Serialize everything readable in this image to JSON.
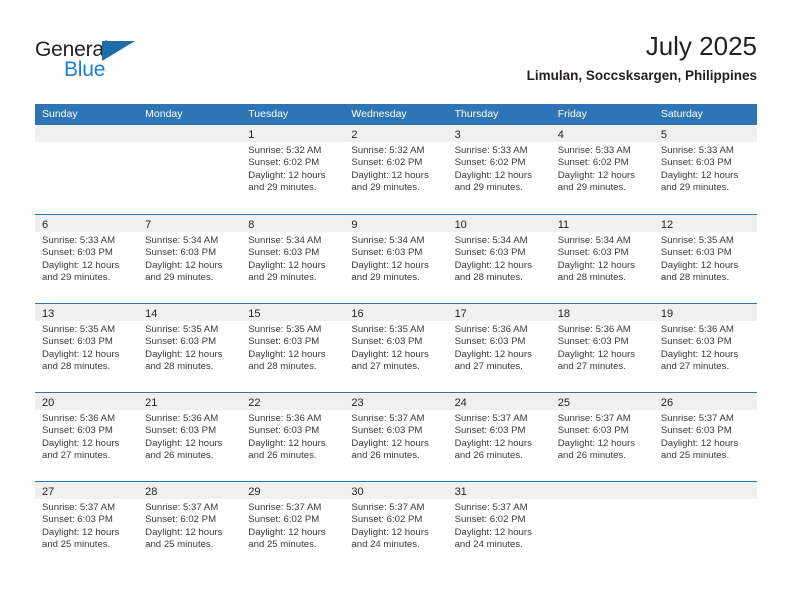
{
  "brand": {
    "name_part1": "General",
    "name_part2": "Blue",
    "triangle_color": "#1b6ca8",
    "blue_color": "#1b7fd4"
  },
  "header": {
    "title": "July 2025",
    "subtitle": "Limulan, Soccsksargen, Philippines"
  },
  "theme": {
    "header_blue": "#2e75b6",
    "daynum_band": "#f0f0f0",
    "text": "#231f20"
  },
  "calendar": {
    "weekday_headers": [
      "Sunday",
      "Monday",
      "Tuesday",
      "Wednesday",
      "Thursday",
      "Friday",
      "Saturday"
    ],
    "weeks": [
      [
        {
          "day": "",
          "sunrise": "",
          "sunset": "",
          "daylight1": "",
          "daylight2": ""
        },
        {
          "day": "",
          "sunrise": "",
          "sunset": "",
          "daylight1": "",
          "daylight2": ""
        },
        {
          "day": "1",
          "sunrise": "Sunrise: 5:32 AM",
          "sunset": "Sunset: 6:02 PM",
          "daylight1": "Daylight: 12 hours",
          "daylight2": "and 29 minutes."
        },
        {
          "day": "2",
          "sunrise": "Sunrise: 5:32 AM",
          "sunset": "Sunset: 6:02 PM",
          "daylight1": "Daylight: 12 hours",
          "daylight2": "and 29 minutes."
        },
        {
          "day": "3",
          "sunrise": "Sunrise: 5:33 AM",
          "sunset": "Sunset: 6:02 PM",
          "daylight1": "Daylight: 12 hours",
          "daylight2": "and 29 minutes."
        },
        {
          "day": "4",
          "sunrise": "Sunrise: 5:33 AM",
          "sunset": "Sunset: 6:02 PM",
          "daylight1": "Daylight: 12 hours",
          "daylight2": "and 29 minutes."
        },
        {
          "day": "5",
          "sunrise": "Sunrise: 5:33 AM",
          "sunset": "Sunset: 6:03 PM",
          "daylight1": "Daylight: 12 hours",
          "daylight2": "and 29 minutes."
        }
      ],
      [
        {
          "day": "6",
          "sunrise": "Sunrise: 5:33 AM",
          "sunset": "Sunset: 6:03 PM",
          "daylight1": "Daylight: 12 hours",
          "daylight2": "and 29 minutes."
        },
        {
          "day": "7",
          "sunrise": "Sunrise: 5:34 AM",
          "sunset": "Sunset: 6:03 PM",
          "daylight1": "Daylight: 12 hours",
          "daylight2": "and 29 minutes."
        },
        {
          "day": "8",
          "sunrise": "Sunrise: 5:34 AM",
          "sunset": "Sunset: 6:03 PM",
          "daylight1": "Daylight: 12 hours",
          "daylight2": "and 29 minutes."
        },
        {
          "day": "9",
          "sunrise": "Sunrise: 5:34 AM",
          "sunset": "Sunset: 6:03 PM",
          "daylight1": "Daylight: 12 hours",
          "daylight2": "and 29 minutes."
        },
        {
          "day": "10",
          "sunrise": "Sunrise: 5:34 AM",
          "sunset": "Sunset: 6:03 PM",
          "daylight1": "Daylight: 12 hours",
          "daylight2": "and 28 minutes."
        },
        {
          "day": "11",
          "sunrise": "Sunrise: 5:34 AM",
          "sunset": "Sunset: 6:03 PM",
          "daylight1": "Daylight: 12 hours",
          "daylight2": "and 28 minutes."
        },
        {
          "day": "12",
          "sunrise": "Sunrise: 5:35 AM",
          "sunset": "Sunset: 6:03 PM",
          "daylight1": "Daylight: 12 hours",
          "daylight2": "and 28 minutes."
        }
      ],
      [
        {
          "day": "13",
          "sunrise": "Sunrise: 5:35 AM",
          "sunset": "Sunset: 6:03 PM",
          "daylight1": "Daylight: 12 hours",
          "daylight2": "and 28 minutes."
        },
        {
          "day": "14",
          "sunrise": "Sunrise: 5:35 AM",
          "sunset": "Sunset: 6:03 PM",
          "daylight1": "Daylight: 12 hours",
          "daylight2": "and 28 minutes."
        },
        {
          "day": "15",
          "sunrise": "Sunrise: 5:35 AM",
          "sunset": "Sunset: 6:03 PM",
          "daylight1": "Daylight: 12 hours",
          "daylight2": "and 28 minutes."
        },
        {
          "day": "16",
          "sunrise": "Sunrise: 5:35 AM",
          "sunset": "Sunset: 6:03 PM",
          "daylight1": "Daylight: 12 hours",
          "daylight2": "and 27 minutes."
        },
        {
          "day": "17",
          "sunrise": "Sunrise: 5:36 AM",
          "sunset": "Sunset: 6:03 PM",
          "daylight1": "Daylight: 12 hours",
          "daylight2": "and 27 minutes."
        },
        {
          "day": "18",
          "sunrise": "Sunrise: 5:36 AM",
          "sunset": "Sunset: 6:03 PM",
          "daylight1": "Daylight: 12 hours",
          "daylight2": "and 27 minutes."
        },
        {
          "day": "19",
          "sunrise": "Sunrise: 5:36 AM",
          "sunset": "Sunset: 6:03 PM",
          "daylight1": "Daylight: 12 hours",
          "daylight2": "and 27 minutes."
        }
      ],
      [
        {
          "day": "20",
          "sunrise": "Sunrise: 5:36 AM",
          "sunset": "Sunset: 6:03 PM",
          "daylight1": "Daylight: 12 hours",
          "daylight2": "and 27 minutes."
        },
        {
          "day": "21",
          "sunrise": "Sunrise: 5:36 AM",
          "sunset": "Sunset: 6:03 PM",
          "daylight1": "Daylight: 12 hours",
          "daylight2": "and 26 minutes."
        },
        {
          "day": "22",
          "sunrise": "Sunrise: 5:36 AM",
          "sunset": "Sunset: 6:03 PM",
          "daylight1": "Daylight: 12 hours",
          "daylight2": "and 26 minutes."
        },
        {
          "day": "23",
          "sunrise": "Sunrise: 5:37 AM",
          "sunset": "Sunset: 6:03 PM",
          "daylight1": "Daylight: 12 hours",
          "daylight2": "and 26 minutes."
        },
        {
          "day": "24",
          "sunrise": "Sunrise: 5:37 AM",
          "sunset": "Sunset: 6:03 PM",
          "daylight1": "Daylight: 12 hours",
          "daylight2": "and 26 minutes."
        },
        {
          "day": "25",
          "sunrise": "Sunrise: 5:37 AM",
          "sunset": "Sunset: 6:03 PM",
          "daylight1": "Daylight: 12 hours",
          "daylight2": "and 26 minutes."
        },
        {
          "day": "26",
          "sunrise": "Sunrise: 5:37 AM",
          "sunset": "Sunset: 6:03 PM",
          "daylight1": "Daylight: 12 hours",
          "daylight2": "and 25 minutes."
        }
      ],
      [
        {
          "day": "27",
          "sunrise": "Sunrise: 5:37 AM",
          "sunset": "Sunset: 6:03 PM",
          "daylight1": "Daylight: 12 hours",
          "daylight2": "and 25 minutes."
        },
        {
          "day": "28",
          "sunrise": "Sunrise: 5:37 AM",
          "sunset": "Sunset: 6:02 PM",
          "daylight1": "Daylight: 12 hours",
          "daylight2": "and 25 minutes."
        },
        {
          "day": "29",
          "sunrise": "Sunrise: 5:37 AM",
          "sunset": "Sunset: 6:02 PM",
          "daylight1": "Daylight: 12 hours",
          "daylight2": "and 25 minutes."
        },
        {
          "day": "30",
          "sunrise": "Sunrise: 5:37 AM",
          "sunset": "Sunset: 6:02 PM",
          "daylight1": "Daylight: 12 hours",
          "daylight2": "and 24 minutes."
        },
        {
          "day": "31",
          "sunrise": "Sunrise: 5:37 AM",
          "sunset": "Sunset: 6:02 PM",
          "daylight1": "Daylight: 12 hours",
          "daylight2": "and 24 minutes."
        },
        {
          "day": "",
          "sunrise": "",
          "sunset": "",
          "daylight1": "",
          "daylight2": ""
        },
        {
          "day": "",
          "sunrise": "",
          "sunset": "",
          "daylight1": "",
          "daylight2": ""
        }
      ]
    ]
  }
}
